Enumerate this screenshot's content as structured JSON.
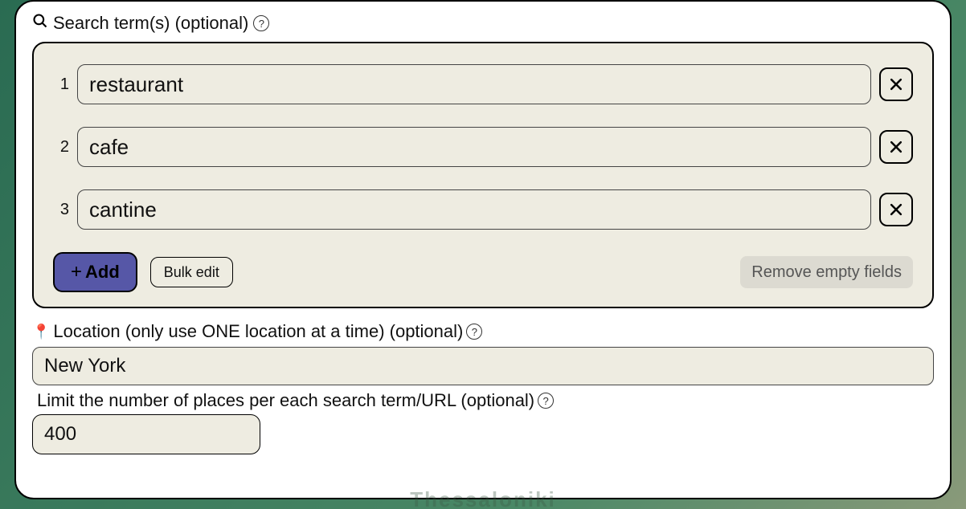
{
  "search": {
    "heading": "Search term(s) (optional)",
    "terms": [
      {
        "index": "1",
        "value": "restaurant"
      },
      {
        "index": "2",
        "value": "cafe"
      },
      {
        "index": "3",
        "value": "cantine"
      }
    ],
    "add_label": "Add",
    "bulk_edit_label": "Bulk edit",
    "remove_empty_label": "Remove empty fields"
  },
  "location": {
    "heading": "Location (only use ONE location at a time) (optional)",
    "value": "New York"
  },
  "limit": {
    "heading": "Limit the number of places per each search term/URL (optional)",
    "value": "400"
  },
  "icons": {
    "help_char": "?",
    "plus_char": "+",
    "step_up": "+",
    "step_down": "−"
  },
  "bg_ghost_text": "Thessaloniki"
}
